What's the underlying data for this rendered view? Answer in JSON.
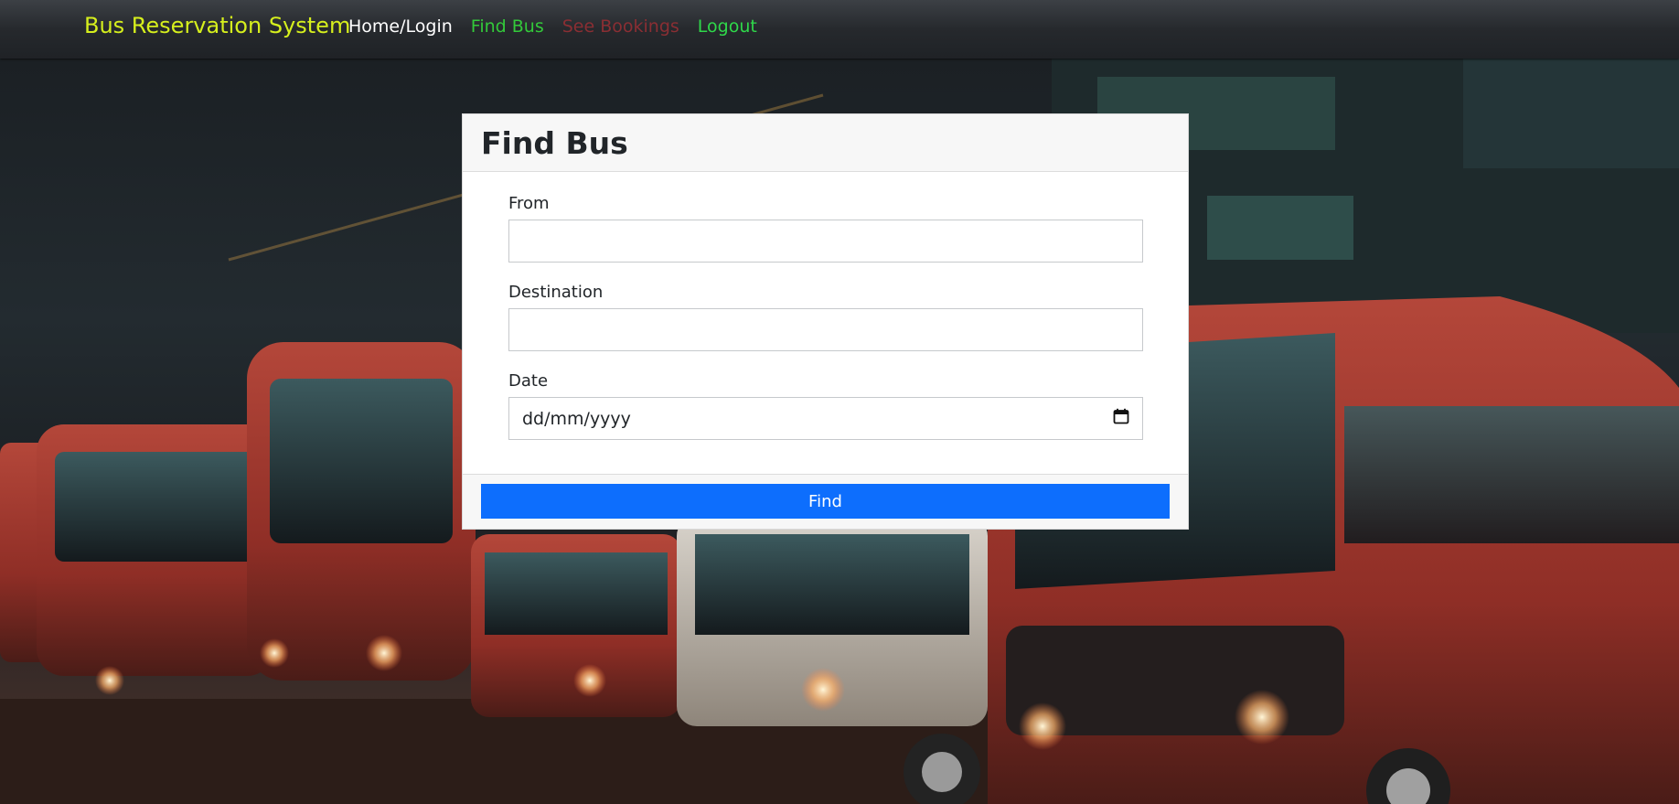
{
  "navbar": {
    "brand": "Bus Reservation System",
    "links": [
      {
        "label": "Home/Login"
      },
      {
        "label": "Find Bus"
      },
      {
        "label": "See Bookings"
      },
      {
        "label": "Logout"
      }
    ]
  },
  "form": {
    "title": "Find Bus",
    "fields": {
      "from": {
        "label": "From",
        "value": ""
      },
      "destination": {
        "label": "Destination",
        "value": ""
      },
      "date": {
        "label": "Date",
        "placeholder": "dd/mm/yyyy",
        "icon": "calendar-icon"
      }
    },
    "submit_label": "Find"
  },
  "colors": {
    "brand": "#d6ef1d",
    "find_bus_link": "#33c93a",
    "see_bookings_link": "#8a2e33",
    "logout_link": "#2fd84a",
    "primary_button": "#0d6efd"
  },
  "background": {
    "description_icon": "bus-fleet-photo"
  }
}
